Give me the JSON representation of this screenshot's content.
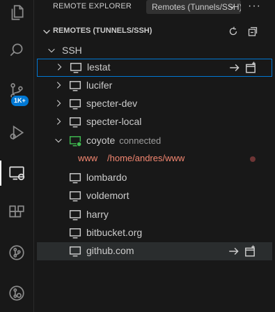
{
  "explorer": {
    "title": "REMOTE EXPLORER",
    "remote_select": "Remotes (Tunnels/SSH)",
    "more": "···"
  },
  "activity": {
    "badge": "1K+"
  },
  "section": {
    "title": "REMOTES (TUNNELS/SSH)"
  },
  "tree": {
    "group": "SSH",
    "hosts": [
      {
        "name": "lestat"
      },
      {
        "name": "lucifer"
      },
      {
        "name": "specter-dev"
      },
      {
        "name": "specter-local"
      },
      {
        "name": "coyote",
        "status": "connected"
      },
      {
        "name": "lombardo"
      },
      {
        "name": "voldemort"
      },
      {
        "name": "harry"
      },
      {
        "name": "bitbucket.org"
      },
      {
        "name": "github.com"
      }
    ],
    "folder": {
      "label": "www",
      "path": "/home/andres/www"
    }
  },
  "colors": {
    "accent": "#0078d4",
    "connected": "#3fb950",
    "folder": "#f48771"
  }
}
